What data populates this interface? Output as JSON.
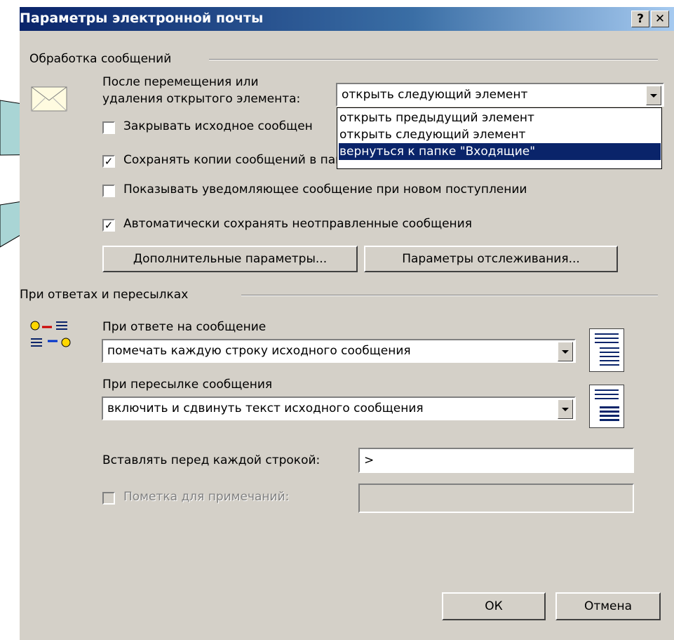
{
  "window": {
    "title": "Параметры электронной почты",
    "help_label": "?",
    "close_label": "✕"
  },
  "message_handling": {
    "group_label": "Обработка сообщений",
    "after_move_label_line1": "После перемещения или",
    "after_move_label_line2": "удаления открытого элемента:",
    "after_move_value": "открыть следующий элемент",
    "dropdown_options": [
      "открыть предыдущий элемент",
      "открыть следующий элемент",
      "вернуться к папке \"Входящие\""
    ],
    "dropdown_selected_index": 2,
    "close_original_label": "Закрывать исходное сообщен",
    "close_original_checked": false,
    "save_copies_label": "Сохранять копии сообщений в папке \"Отправленные\"",
    "save_copies_checked": true,
    "notify_label": "Показывать уведомляющее сообщение при новом поступлении",
    "notify_checked": false,
    "autosave_label": "Автоматически сохранять неотправленные сообщения",
    "autosave_checked": true,
    "advanced_button": "Дополнительные параметры...",
    "tracking_button": "Параметры отслеживания..."
  },
  "replies_forwards": {
    "group_label": "При ответах и пересылках",
    "reply_label": "При ответе на сообщение",
    "reply_value": "помечать каждую строку исходного сообщения",
    "forward_label": "При пересылке сообщения",
    "forward_value": "включить и сдвинуть текст исходного сообщения",
    "prefix_label": "Вставлять перед каждой строкой:",
    "prefix_value": ">",
    "mark_comments_label": "Пометка для примечаний:",
    "mark_comments_checked": false,
    "mark_comments_value": ""
  },
  "footer": {
    "ok_label": "ОК",
    "cancel_label": "Отмена"
  },
  "icons": [
    "envelope-icon",
    "reply-forward-icon",
    "reply-preview-icon",
    "forward-preview-icon",
    "dropdown-arrow-icon"
  ],
  "colors": {
    "dialog_bg": "#d4d0c8",
    "title_bar_start": "#0a246a",
    "title_bar_end": "#a6caf0",
    "selection": "#0a246a",
    "callout": "#a9d5d5"
  }
}
